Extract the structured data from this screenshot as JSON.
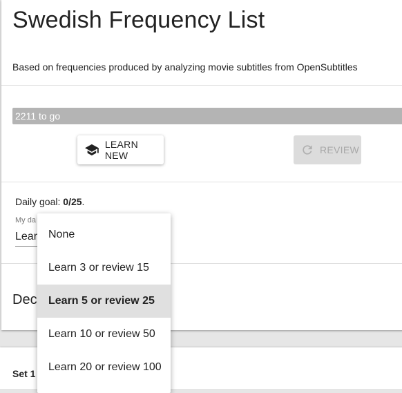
{
  "header": {
    "title": "Swedish Frequency List",
    "subtitle": "Based on frequencies produced by analyzing movie subtitles from OpenSubtitles"
  },
  "progress": {
    "label": "2211 to go",
    "fraction_complete": 0
  },
  "actions": {
    "learn_new_label": "LEARN NEW",
    "learn_new_icon": "graduation-cap-icon",
    "review_label": "REVIEW",
    "review_icon": "refresh-icon",
    "review_enabled": false
  },
  "daily_goal": {
    "prefix": "Daily goal: ",
    "current": "0",
    "separator": "/",
    "target": "25",
    "suffix": ".",
    "select_label": "My da",
    "select_value": "Lear"
  },
  "dropdown": {
    "options": [
      "None",
      "Learn 3 or review 15",
      "Learn 5 or review 25",
      "Learn 10 or review 50",
      "Learn 20 or review 100"
    ],
    "selected_index": 2
  },
  "decks_section": {
    "heading": "Deck"
  },
  "sets": {
    "first_label": "Set 1"
  },
  "colors": {
    "progress_track": "#b4b4b4",
    "selected_option_bg": "#e0e0e0",
    "disabled_button_bg": "#dcdcdc"
  }
}
